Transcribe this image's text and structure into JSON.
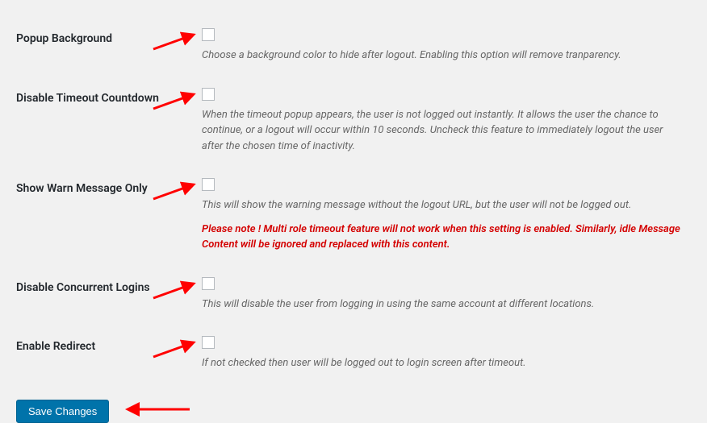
{
  "settings": {
    "popup_background": {
      "label": "Popup Background",
      "description": "Choose a background color to hide after logout. Enabling this option will remove tranparency."
    },
    "disable_timeout": {
      "label": "Disable Timeout Countdown",
      "description": "When the timeout popup appears, the user is not logged out instantly. It allows the user the chance to continue, or a logout will occur within 10 seconds. Uncheck this feature to immediately logout the user after the chosen time of inactivity."
    },
    "show_warn": {
      "label": "Show Warn Message Only",
      "description": "This will show the warning message without the logout URL, but the user will not be logged out.",
      "warning": "Please note ! Multi role timeout feature will not work when this setting is enabled. Similarly, idle Message Content will be ignored and replaced with this content."
    },
    "disable_concurrent": {
      "label": "Disable Concurrent Logins",
      "description": "This will disable the user from logging in using the same account at different locations."
    },
    "enable_redirect": {
      "label": "Enable Redirect",
      "description": "If not checked then user will be logged out to login screen after timeout."
    },
    "submit_label": "Save Changes"
  }
}
